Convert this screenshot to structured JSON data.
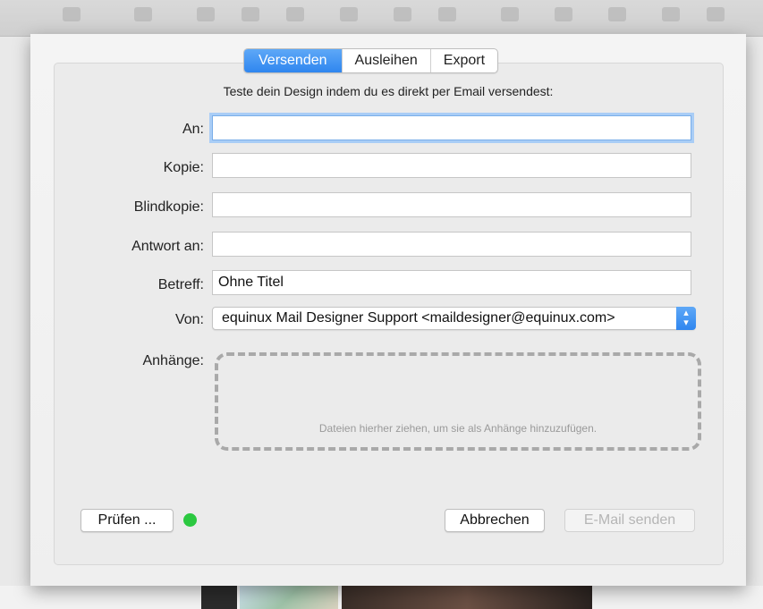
{
  "tabs": [
    {
      "label": "Versenden",
      "active": true
    },
    {
      "label": "Ausleihen",
      "active": false
    },
    {
      "label": "Export",
      "active": false
    }
  ],
  "intro": "Teste dein Design indem du es direkt per Email versendest:",
  "form": {
    "to_label": "An:",
    "to_value": "",
    "cc_label": "Kopie:",
    "cc_value": "",
    "bcc_label": "Blindkopie:",
    "bcc_value": "",
    "reply_label": "Antwort an:",
    "reply_value": "",
    "subject_label": "Betreff:",
    "subject_value": "Ohne Titel",
    "from_label": "Von:",
    "from_value": "equinux Mail Designer Support <maildesigner@equinux.com>",
    "attachments_label": "Anhänge:",
    "dropzone_hint": "Dateien hierher ziehen, um sie als Anhänge hinzuzufügen."
  },
  "buttons": {
    "check": "Prüfen ...",
    "cancel": "Abbrechen",
    "send": "E-Mail senden"
  },
  "status": {
    "color": "#2bc840",
    "state": "ok"
  },
  "icons": {
    "stepper": "up-down-chevron-icon"
  },
  "colors": {
    "accent": "#3b8ff1"
  }
}
